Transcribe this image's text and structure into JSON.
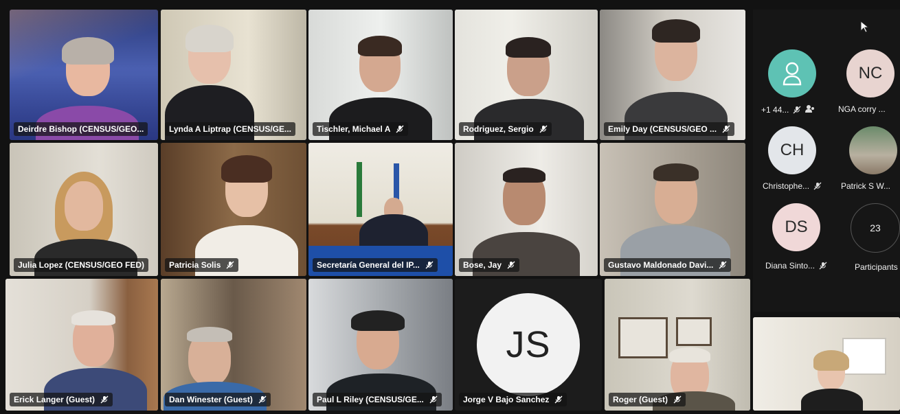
{
  "tiles": [
    {
      "name": "Deirdre Bishop (CENSUS/GEO...",
      "muted": false
    },
    {
      "name": "Lynda A Liptrap (CENSUS/GE...",
      "muted": false
    },
    {
      "name": "Tischler, Michael A",
      "muted": true
    },
    {
      "name": "Rodriguez, Sergio",
      "muted": true
    },
    {
      "name": "Emily Day (CENSUS/GEO ...",
      "muted": true
    },
    {
      "name": "Julia Lopez (CENSUS/GEO FED)",
      "muted": false
    },
    {
      "name": "Patricia Solis",
      "muted": true
    },
    {
      "name": "Secretaría General del IP...",
      "muted": true
    },
    {
      "name": "Bose, Jay",
      "muted": true
    },
    {
      "name": "Gustavo Maldonado Davi...",
      "muted": true
    },
    {
      "name": "Erick Langer (Guest)",
      "muted": true
    },
    {
      "name": "Dan Winester (Guest)",
      "muted": true
    },
    {
      "name": "Paul L Riley (CENSUS/GE...",
      "muted": true
    },
    {
      "name": "Jorge V Bajo Sanchez",
      "muted": true,
      "initials": "JS"
    },
    {
      "name": "Roger (Guest)",
      "muted": true
    }
  ],
  "panel": {
    "participants": [
      {
        "label": "+1 44...",
        "avatar": "person-icon",
        "color": "#5ec2b4"
      },
      {
        "label": "NGA corry ...",
        "initials": "NC",
        "color": "#e8d4d0"
      },
      {
        "label": "Christophe...",
        "initials": "CH",
        "color": "#e3e6ea"
      },
      {
        "label": "Patrick S W...",
        "avatar": "photo"
      },
      {
        "label": "Diana Sinto...",
        "initials": "DS",
        "color": "#f0d8d8"
      }
    ],
    "participant_count": "23",
    "participants_label": "Participants"
  },
  "colors": {
    "active_speaker": "#6b7fd8",
    "background": "#121212"
  }
}
